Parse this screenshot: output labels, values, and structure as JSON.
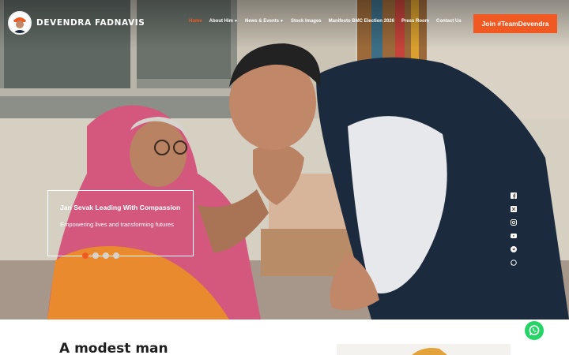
{
  "brand": {
    "name": "DEVENDRA FADNAVIS"
  },
  "nav": {
    "items": [
      {
        "label": "Home",
        "active": true,
        "dropdown": false
      },
      {
        "label": "About Him",
        "active": false,
        "dropdown": true
      },
      {
        "label": "News & Events",
        "active": false,
        "dropdown": true
      },
      {
        "label": "Stock Images",
        "active": false,
        "dropdown": false
      },
      {
        "label": "Manifesto BMC Election 2026",
        "active": false,
        "dropdown": false
      },
      {
        "label": "Press Room",
        "active": false,
        "dropdown": false
      },
      {
        "label": "Contact Us",
        "active": false,
        "dropdown": false
      }
    ],
    "cta": "Join #TeamDevendra"
  },
  "hero": {
    "slide": {
      "title": "Jan Sevak Leading With Compassion",
      "subtitle": "Empowering lives and transforming futures"
    },
    "slide_count": 4,
    "active_slide": 1,
    "social_icons": [
      "facebook-icon",
      "x-icon",
      "instagram-icon",
      "youtube-icon",
      "telegram-icon",
      "whatsapp-icon"
    ]
  },
  "section": {
    "title": "A modest man"
  },
  "colors": {
    "accent": "#f05a22",
    "whatsapp": "#25d366",
    "text_dark": "#1e1e1e"
  }
}
